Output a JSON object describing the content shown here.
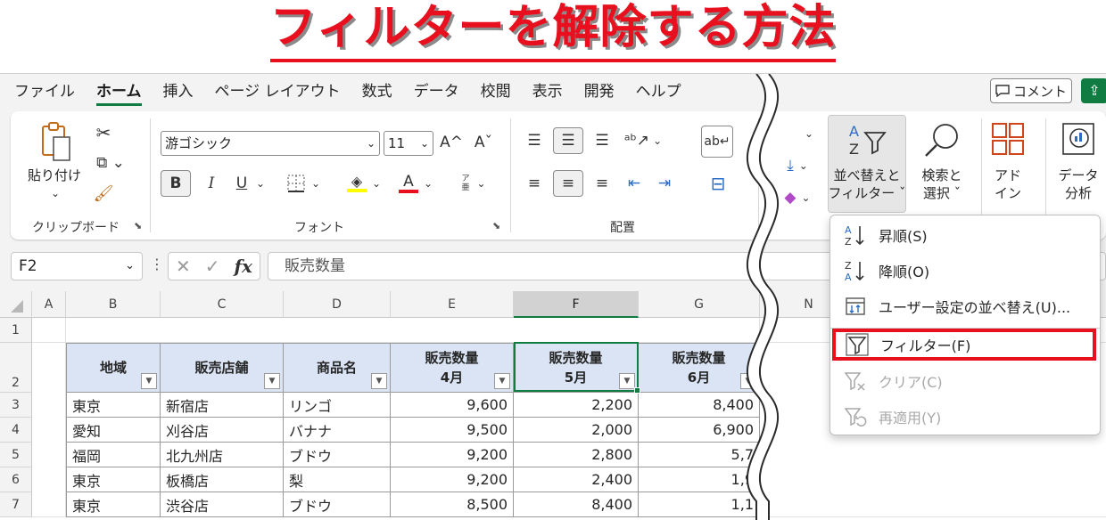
{
  "title": "フィルターを解除する方法",
  "menu": {
    "tabs": [
      "ファイル",
      "ホーム",
      "挿入",
      "ページ レイアウト",
      "数式",
      "データ",
      "校閲",
      "表示",
      "開発",
      "ヘルプ"
    ],
    "active_tab": "ホーム",
    "comment_label": "コメント"
  },
  "ribbon": {
    "clipboard": {
      "paste_label": "貼り付け",
      "group_label": "クリップボード"
    },
    "font": {
      "font_name": "游ゴシック",
      "font_size": "11",
      "bold": "B",
      "italic": "I",
      "underline": "U",
      "grow": "A^",
      "shrink": "Aˇ",
      "font_color_letter": "A",
      "phonetic_top": "ア",
      "phonetic_bottom": "亜",
      "group_label": "フォント",
      "highlight_color": "#ffff00",
      "font_color": "#e8101e"
    },
    "alignment": {
      "group_label": "配置"
    },
    "sort_filter": {
      "label_line1": "並べ替えと",
      "label_line2": "フィルター ˇ"
    },
    "find_select": {
      "label_line1": "検索と",
      "label_line2": "選択 ˇ"
    },
    "addins": {
      "label_line1": "アド",
      "label_line2": "イン"
    },
    "analysis": {
      "label_line1": "データ",
      "label_line2": "分析"
    }
  },
  "formula_bar": {
    "name_box": "F2",
    "formula": "販売数量"
  },
  "grid": {
    "columns": [
      "A",
      "B",
      "C",
      "D",
      "E",
      "F",
      "G",
      "N"
    ],
    "selected_column": "F",
    "row_numbers": [
      "1",
      "2",
      "3",
      "4",
      "5",
      "6",
      "7"
    ],
    "headers": [
      {
        "line1": "地域",
        "line2": ""
      },
      {
        "line1": "販売店舗",
        "line2": ""
      },
      {
        "line1": "商品名",
        "line2": ""
      },
      {
        "line1": "販売数量",
        "line2": "4月"
      },
      {
        "line1": "販売数量",
        "line2": "5月"
      },
      {
        "line1": "販売数量",
        "line2": "6月"
      }
    ],
    "rows": [
      [
        "東京",
        "新宿店",
        "リンゴ",
        "9,600",
        "2,200",
        "8,400"
      ],
      [
        "愛知",
        "刈谷店",
        "バナナ",
        "9,500",
        "2,000",
        "6,900"
      ],
      [
        "福岡",
        "北九州店",
        "ブドウ",
        "9,200",
        "2,800",
        "5,7"
      ],
      [
        "東京",
        "板橋店",
        "梨",
        "9,200",
        "2,400",
        "1,9"
      ],
      [
        "東京",
        "渋谷店",
        "ブドウ",
        "8,500",
        "8,400",
        "1,1"
      ]
    ]
  },
  "dropdown": {
    "items": [
      {
        "label": "昇順(S)",
        "icon": "sort-ascending-icon",
        "disabled": false
      },
      {
        "label": "降順(O)",
        "icon": "sort-descending-icon",
        "disabled": false
      },
      {
        "label": "ユーザー設定の並べ替え(U)...",
        "icon": "custom-sort-icon",
        "disabled": false
      },
      {
        "label": "フィルター(F)",
        "icon": "filter-icon",
        "disabled": false,
        "highlighted": true
      },
      {
        "label": "クリア(C)",
        "icon": "clear-filter-icon",
        "disabled": true
      },
      {
        "label": "再適用(Y)",
        "icon": "reapply-filter-icon",
        "disabled": true
      }
    ],
    "highlight_color": "#e8101e"
  }
}
